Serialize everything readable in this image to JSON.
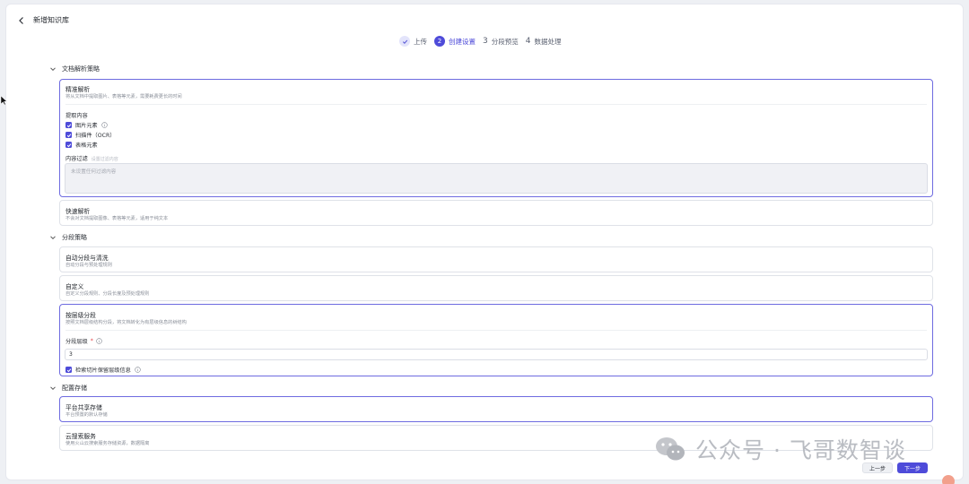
{
  "header": {
    "title": "新增知识库"
  },
  "steps": [
    {
      "num": "",
      "label": "上传",
      "state": "done"
    },
    {
      "num": "2",
      "label": "创建设置",
      "state": "active"
    },
    {
      "num": "3",
      "label": "分段预览",
      "state": "todo"
    },
    {
      "num": "4",
      "label": "数据处理",
      "state": "todo"
    }
  ],
  "parse": {
    "section_title": "文档解析策略",
    "precise": {
      "title": "精准解析",
      "desc": "将从文档中提取图片、表格等元素，需要耗费更长的时间",
      "extract_label": "提取内容",
      "options": [
        "图片元素",
        "扫描件（OCR）",
        "表格元素"
      ],
      "filter_label": "内容过滤",
      "filter_hint": "设置过滤内容",
      "filter_placeholder": "未设置任何过滤内容"
    },
    "fast": {
      "title": "快速解析",
      "desc": "不会对文档提取图像、表格等元素，适用于纯文本"
    }
  },
  "segment": {
    "section_title": "分段策略",
    "auto": {
      "title": "自动分段与清洗",
      "desc": "自动分段与预处理规则"
    },
    "custom": {
      "title": "自定义",
      "desc": "自定义分段规则、分段长度及预处理规则"
    },
    "level": {
      "title": "按层级分段",
      "desc": "按照文档层级结构分段，将文档转化为有层级信息的树结构",
      "level_label": "分段层级",
      "level_value": "3",
      "keep_label": "检索切片保留层级信息"
    }
  },
  "storage": {
    "section_title": "配置存储",
    "platform": {
      "title": "平台共享存储",
      "desc": "平台预置的默认存储"
    },
    "cloud": {
      "title": "云搜索服务",
      "desc": "使用火山云搜索服务存储资源，数据隔离"
    }
  },
  "watermark": "公众号 · 飞哥数智谈",
  "footer": {
    "prev_label": "上一步",
    "next_label": "下一步"
  },
  "colors": {
    "accent": "#4e4bd9",
    "selected_border": "#6e6be0"
  }
}
